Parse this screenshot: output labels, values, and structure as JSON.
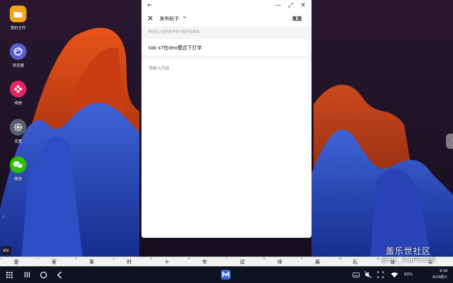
{
  "desktop": {
    "icons": [
      {
        "label": "我的文件",
        "icon": "folder-icon",
        "color": "#f4a51c"
      },
      {
        "label": "浏览器",
        "icon": "browser-icon",
        "color": "#5a5fcf"
      },
      {
        "label": "相册",
        "icon": "gallery-icon",
        "color": "#e6245f"
      },
      {
        "label": "设置",
        "icon": "gear-icon",
        "color": "#56606c"
      },
      {
        "label": "微信",
        "icon": "wechat-icon",
        "color": "#2dc100"
      }
    ]
  },
  "window": {
    "controls": {
      "back": "←",
      "minimize": "—",
      "maximize": "⤢",
      "close": "✕"
    },
    "header": {
      "close": "✕",
      "title": "发布帖子",
      "chevron": "⌄",
      "send": "发送"
    },
    "breadcrumb": "综合区>星粉的声音>提问及建议",
    "title_field": {
      "value": "tab s7在dex模式下打字"
    },
    "content_field": {
      "placeholder": "请输入内容..."
    }
  },
  "ime": {
    "composition": "shi",
    "candidates": [
      {
        "num": "1",
        "word": "是"
      },
      {
        "num": "2",
        "word": "室"
      },
      {
        "num": "3",
        "word": "事"
      },
      {
        "num": "4",
        "word": "时"
      },
      {
        "num": "5",
        "word": "十"
      },
      {
        "num": "6",
        "word": "市"
      },
      {
        "num": "7",
        "word": "试"
      },
      {
        "num": "8",
        "word": "师"
      },
      {
        "num": "9",
        "word": "屎"
      },
      {
        "num": "10",
        "word": "石"
      },
      {
        "num": "11",
        "word": "使"
      },
      {
        "num": "12",
        "word": "实"
      }
    ]
  },
  "taskbar": {
    "left": [
      "apps-icon",
      "recents-icon",
      "home-icon",
      "back-icon"
    ],
    "tray": {
      "battery": "93%",
      "time": "9:18",
      "date": "6/19周六"
    }
  },
  "watermark": {
    "line1": "盖乐世社区",
    "line2": "@GC_9SJPEGSR"
  }
}
